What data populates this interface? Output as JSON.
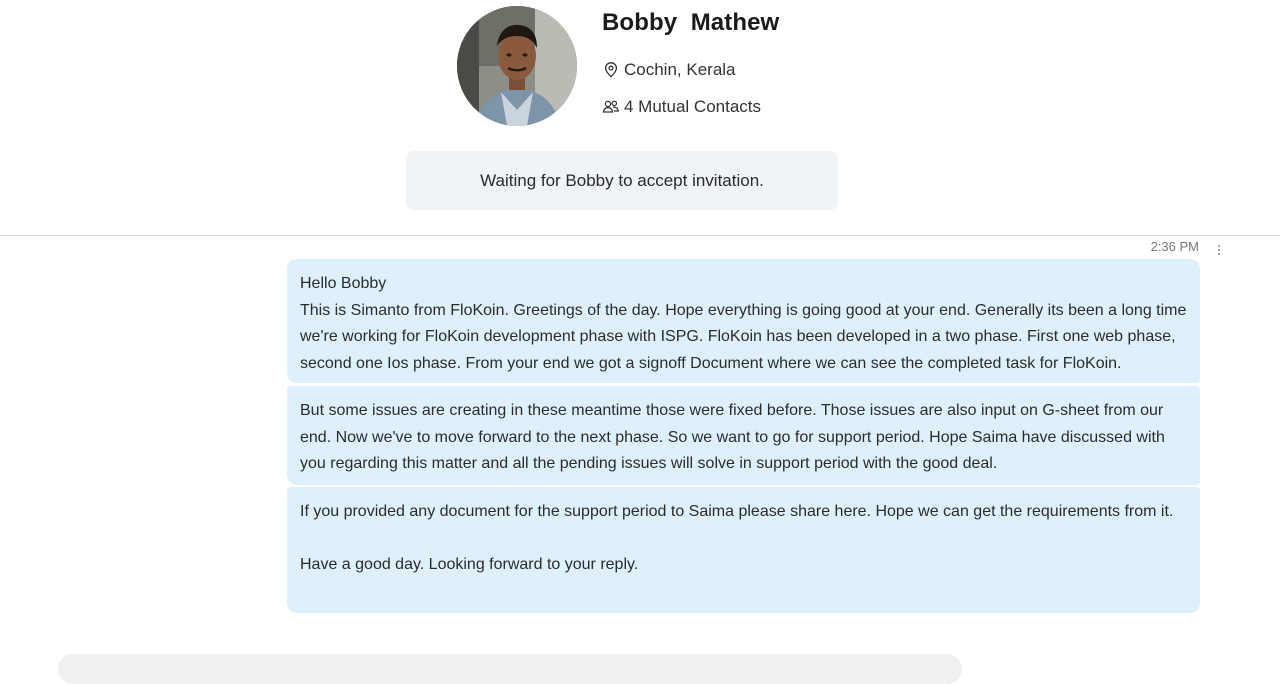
{
  "contact": {
    "name": "Bobby  Mathew",
    "location": "Cochin, Kerala",
    "mutual_contacts": "4 Mutual Contacts",
    "icons": {
      "location": "map-pin-icon",
      "contacts": "people-icon"
    }
  },
  "invitation": {
    "status_text": "Waiting for Bobby to accept invitation."
  },
  "message": {
    "timestamp": "2:36 PM",
    "menu_icon": "more-vertical-icon",
    "bubble_color": "#dff0fd",
    "parts": {
      "first": {
        "greeting": "Hello Bobby",
        "body": "This is Simanto from FloKoin. Greetings of the day. Hope everything is going good at your end. Generally its been a long time we're working for FloKoin development phase with ISPG. FloKoin has been developed in a two phase. First one web phase, second one Ios phase. From your end we got a signoff Document where we can see the completed task for FloKoin."
      },
      "second": {
        "body": "But some issues are creating in these meantime those were fixed before. Those issues are also input on G-sheet from our end. Now we've to move forward to the next phase. So we want to go for support period. Hope Saima have discussed with you regarding this matter and all the pending issues will solve in support period with the good deal."
      },
      "third": {
        "body": "If you provided any document for the support period to Saima please share here. Hope we can get the requirements from it.",
        "closing": "Have a good day. Looking forward to your reply."
      }
    }
  },
  "colors": {
    "invite_bg": "#f0f3f7",
    "divider": "#dcdcdc"
  }
}
